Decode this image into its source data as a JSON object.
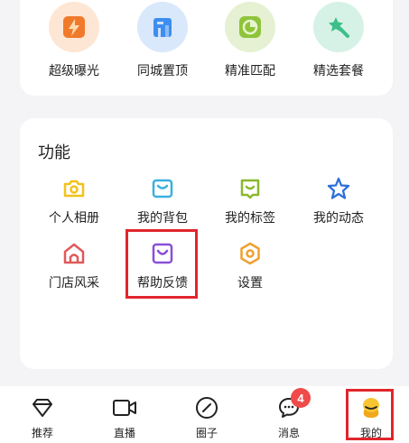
{
  "promotions": [
    {
      "label": "超级曝光",
      "icon": "lightning-bag-icon",
      "color": "#f07a2a"
    },
    {
      "label": "同城置顶",
      "icon": "building-icon",
      "color": "#3d8ef0"
    },
    {
      "label": "精准匹配",
      "icon": "pie-chart-icon",
      "color": "#8fc43a"
    },
    {
      "label": "精选套餐",
      "icon": "magic-wand-icon",
      "color": "#3dbf8a"
    }
  ],
  "functions": {
    "title": "功能",
    "items": [
      {
        "label": "个人相册",
        "icon": "camera-icon",
        "color": "#f2c21b"
      },
      {
        "label": "我的背包",
        "icon": "backpack-icon",
        "color": "#3ab0e0"
      },
      {
        "label": "我的标签",
        "icon": "tag-icon",
        "color": "#8ab82e"
      },
      {
        "label": "我的动态",
        "icon": "star-icon",
        "color": "#2f6fd8"
      },
      {
        "label": "门店风采",
        "icon": "store-icon",
        "color": "#e05a5a"
      },
      {
        "label": "帮助反馈",
        "icon": "feedback-icon",
        "color": "#8a4fd8"
      },
      {
        "label": "设置",
        "icon": "hexagon-settings-icon",
        "color": "#f0a030"
      }
    ]
  },
  "tabbar": {
    "tabs": [
      {
        "label": "推荐",
        "icon": "diamond-icon"
      },
      {
        "label": "直播",
        "icon": "video-camera-icon"
      },
      {
        "label": "圈子",
        "icon": "compass-icon"
      },
      {
        "label": "消息",
        "icon": "chat-icon",
        "badge": "4"
      },
      {
        "label": "我的",
        "icon": "profile-avatar-icon"
      }
    ]
  }
}
